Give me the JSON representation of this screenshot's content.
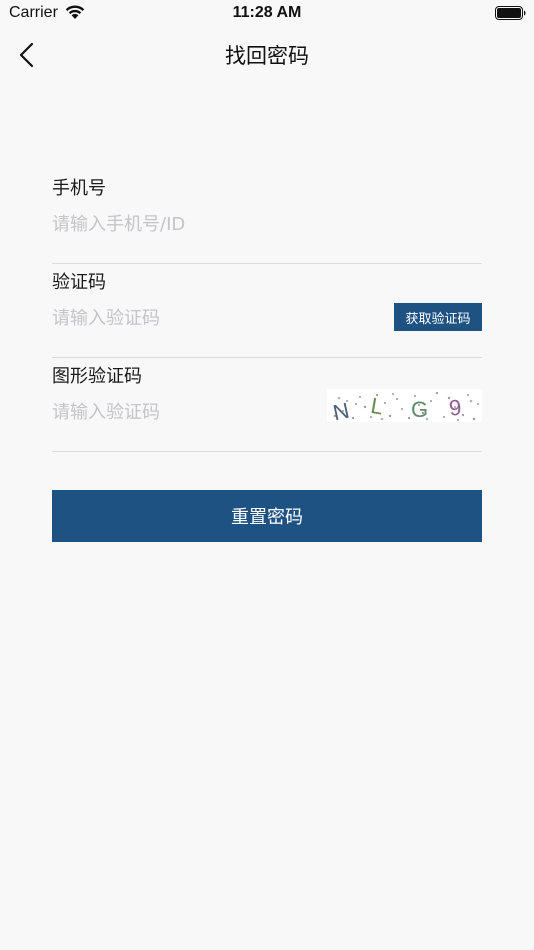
{
  "status_bar": {
    "carrier": "Carrier",
    "time": "11:28 AM"
  },
  "nav": {
    "title": "找回密码",
    "back_icon": "chevron-left-icon"
  },
  "form": {
    "phone": {
      "label": "手机号",
      "placeholder": "请输入手机号/ID",
      "value": ""
    },
    "sms_code": {
      "label": "验证码",
      "placeholder": "请输入验证码",
      "value": "",
      "get_code_label": "获取验证码"
    },
    "captcha": {
      "label": "图形验证码",
      "placeholder": "请输入验证码",
      "value": "",
      "image_chars": [
        "N",
        "L",
        "G",
        "9"
      ]
    }
  },
  "actions": {
    "reset_label": "重置密码"
  },
  "colors": {
    "primary": "#1e5283",
    "background": "#f8f8f8",
    "placeholder": "#c4c4c9",
    "divider": "#dcdcdc"
  }
}
